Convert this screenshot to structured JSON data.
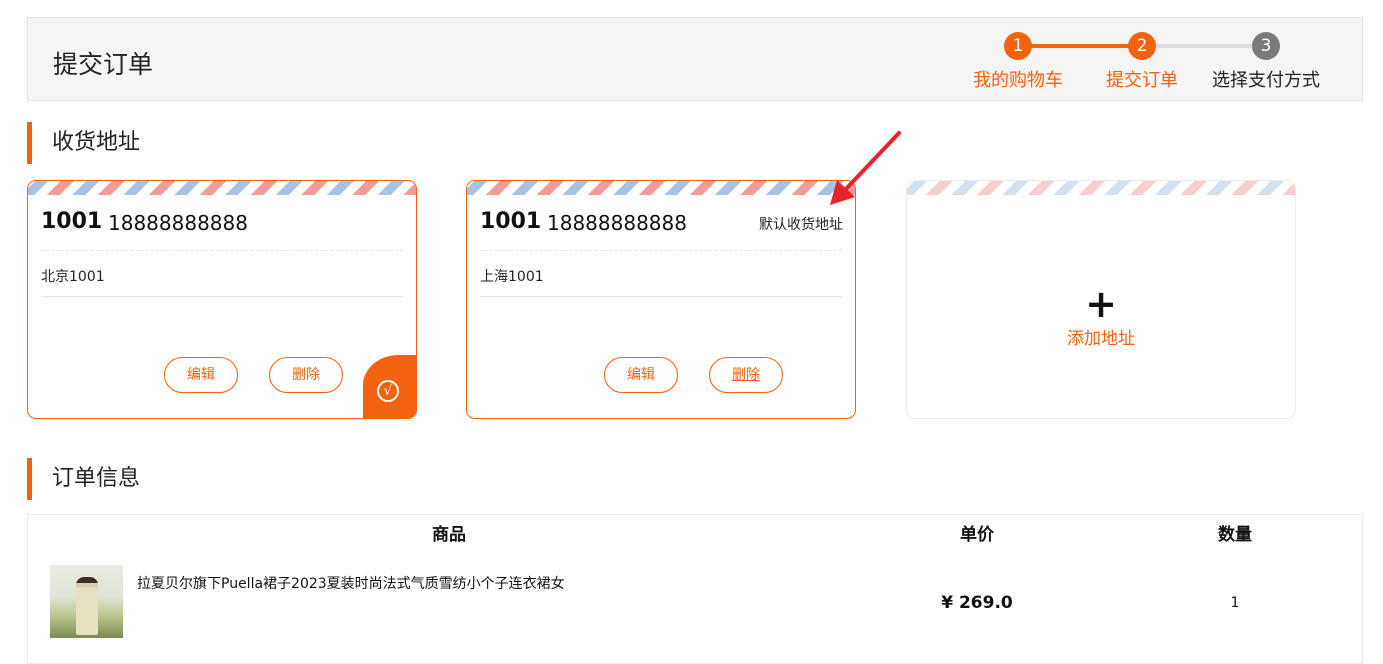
{
  "header": {
    "title": "提交订单",
    "steps": [
      {
        "number": "1",
        "label": "我的购物车",
        "state": "done"
      },
      {
        "number": "2",
        "label": "提交订单",
        "state": "done"
      },
      {
        "number": "3",
        "label": "选择支付方式",
        "state": "todo"
      }
    ]
  },
  "address_section": {
    "title": "收货地址",
    "cards": [
      {
        "name": "1001",
        "phone": "18888888888",
        "default_label": "",
        "address": "北京1001",
        "edit_label": "编辑",
        "delete_label": "删除",
        "selected": true
      },
      {
        "name": "1001",
        "phone": "18888888888",
        "default_label": "默认收货地址",
        "address": "上海1001",
        "edit_label": "编辑",
        "delete_label": "删除",
        "selected": false
      }
    ],
    "add": {
      "plus": "+",
      "label": "添加地址"
    }
  },
  "order_section": {
    "title": "订单信息",
    "columns": {
      "product": "商品",
      "price": "单价",
      "quantity": "数量"
    },
    "items": [
      {
        "name": "拉夏贝尔旗下Puella裙子2023夏装时尚法式气质雪纺小个子连衣裙女",
        "price": "¥ 269.0",
        "quantity": "1"
      }
    ]
  },
  "colors": {
    "accent": "#f5620f",
    "inactive_step": "#7a7a7a",
    "annotation_arrow": "#e8222c"
  },
  "icons": {
    "selected_check": "check-circle-icon",
    "annotation": "red-arrow-icon"
  }
}
